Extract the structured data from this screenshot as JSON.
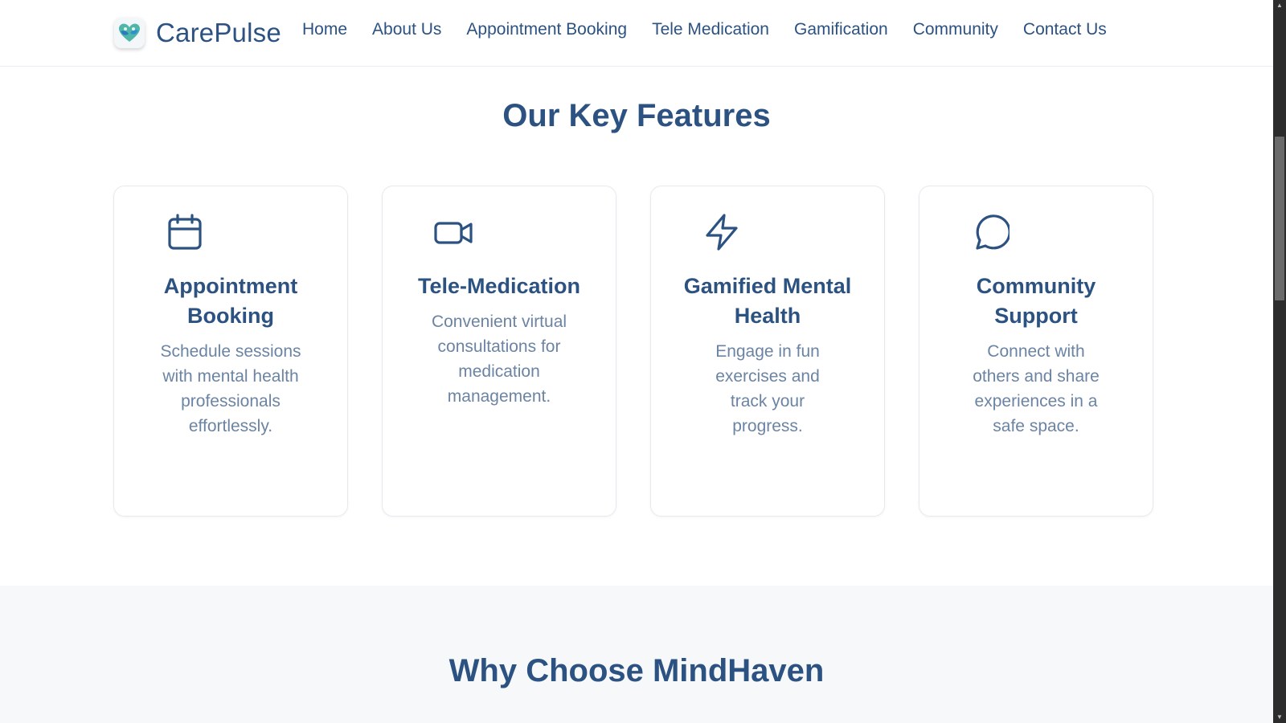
{
  "brand": {
    "name": "CarePulse",
    "logo_icon": "heart-hands-logo-icon"
  },
  "nav": [
    {
      "label": "Home"
    },
    {
      "label": "About Us"
    },
    {
      "label": "Appointment Booking"
    },
    {
      "label": "Tele Medication"
    },
    {
      "label": "Gamification"
    },
    {
      "label": "Community"
    },
    {
      "label": "Contact Us"
    }
  ],
  "features": {
    "title": "Our Key Features",
    "cards": [
      {
        "icon": "calendar-icon",
        "title": "Appointment Booking",
        "text": "Schedule sessions with mental health professionals effortlessly."
      },
      {
        "icon": "video-camera-icon",
        "title": "Tele-Medication",
        "text": "Convenient virtual consultations for medication management."
      },
      {
        "icon": "lightning-bolt-icon",
        "title": "Gamified Mental Health",
        "text": "Engage in fun exercises and track your progress."
      },
      {
        "icon": "chat-bubble-icon",
        "title": "Community Support",
        "text": "Connect with others and share experiences in a safe space."
      }
    ]
  },
  "why": {
    "title": "Why Choose MindHaven"
  },
  "colors": {
    "primary": "#2c5282",
    "muted_text": "#6b84a3",
    "section_bg": "#f6f8fa",
    "border": "#e6eaef"
  }
}
